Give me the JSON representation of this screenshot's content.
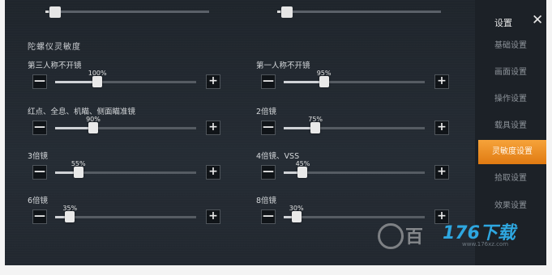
{
  "section_title": "陀螺仪灵敏度",
  "top_partial": [
    {
      "value": 0.02
    },
    {
      "value": 0.02
    }
  ],
  "rows": [
    {
      "label": "第三人称不开镜",
      "percent_text": "100%",
      "value": 0.3
    },
    {
      "label": "第一人称不开镜",
      "percent_text": "95%",
      "value": 0.285
    },
    {
      "label": "红点、全息、机瞄、侧面瞄准镜",
      "percent_text": "90%",
      "value": 0.27
    },
    {
      "label": "2倍镜",
      "percent_text": "75%",
      "value": 0.225
    },
    {
      "label": "3倍镜",
      "percent_text": "55%",
      "value": 0.165
    },
    {
      "label": "4倍镜、VSS",
      "percent_text": "45%",
      "value": 0.135
    },
    {
      "label": "6倍镜",
      "percent_text": "35%",
      "value": 0.105
    },
    {
      "label": "8倍镜",
      "percent_text": "30%",
      "value": 0.09
    }
  ],
  "button_symbols": {
    "minus": "—",
    "plus": "+"
  },
  "sidebar": {
    "title": "设置",
    "close": "✕",
    "items": [
      {
        "label": "基础设置",
        "active": false
      },
      {
        "label": "画面设置",
        "active": false
      },
      {
        "label": "操作设置",
        "active": false
      },
      {
        "label": "载具设置",
        "active": false
      },
      {
        "label": "灵敏度设置",
        "active": true
      },
      {
        "label": "拾取设置",
        "active": false
      },
      {
        "label": "效果设置",
        "active": false
      }
    ]
  },
  "watermark": {
    "cn": "百",
    "brand": "176下载",
    "url": "www.176xz.com"
  },
  "colors": {
    "accent": "#f08c1e",
    "panel": "#20262d"
  }
}
